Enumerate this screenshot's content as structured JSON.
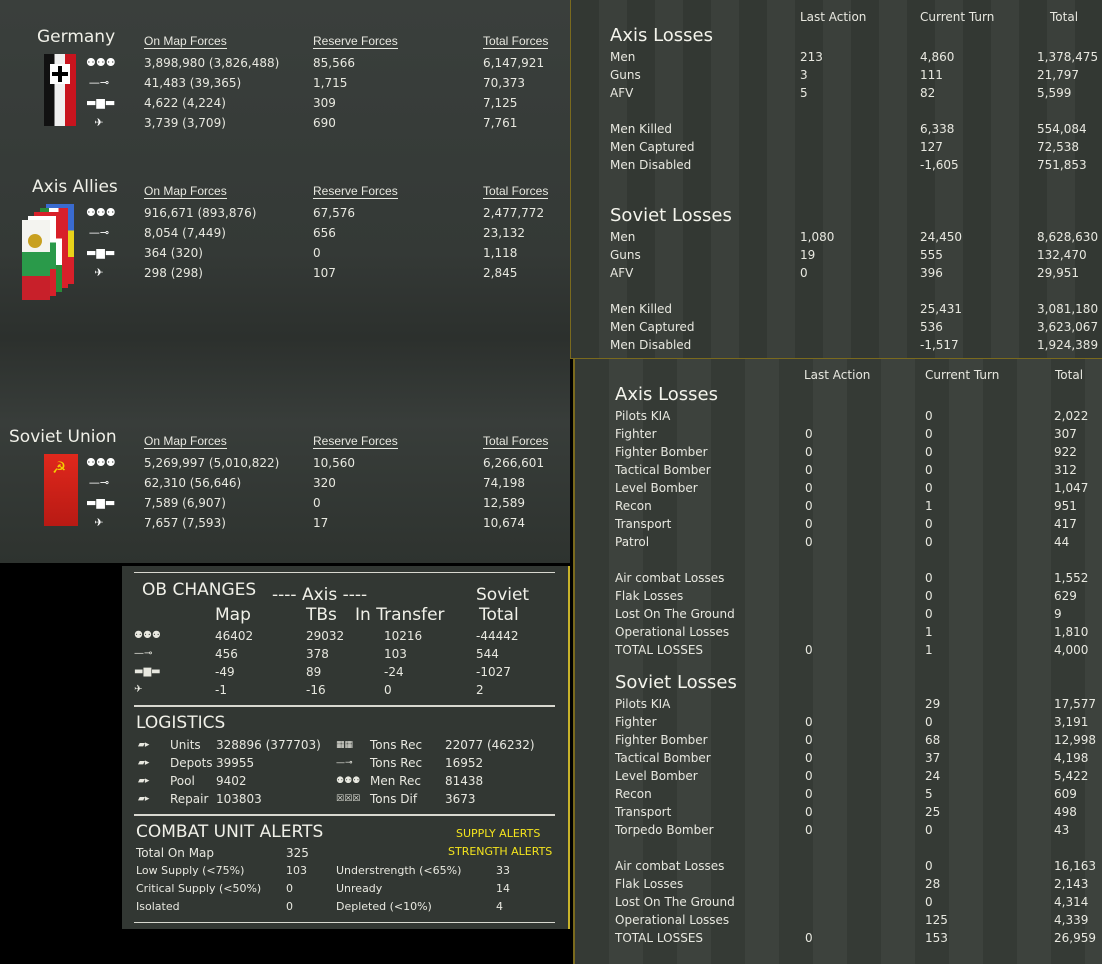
{
  "forces": {
    "headers": {
      "on_map": "On Map Forces",
      "reserve": "Reserve Forces",
      "total": "Total Forces"
    },
    "icons": [
      "infantry-icon",
      "gun-icon",
      "tank-icon",
      "aircraft-icon"
    ],
    "icon_glyphs": [
      "⚉⚉⚉",
      "—⊸",
      "▬▆▬",
      "✈"
    ],
    "countries": [
      {
        "name": "Germany",
        "rows": [
          {
            "on_map": "3,898,980 (3,826,488)",
            "reserve": "85,566",
            "total": "6,147,921"
          },
          {
            "on_map": "41,483 (39,365)",
            "reserve": "1,715",
            "total": "70,373"
          },
          {
            "on_map": "4,622 (4,224)",
            "reserve": "309",
            "total": "7,125"
          },
          {
            "on_map": "3,739 (3,709)",
            "reserve": "690",
            "total": "7,761"
          }
        ]
      },
      {
        "name": "Axis Allies",
        "rows": [
          {
            "on_map": "916,671 (893,876)",
            "reserve": "67,576",
            "total": "2,477,772"
          },
          {
            "on_map": "8,054 (7,449)",
            "reserve": "656",
            "total": "23,132"
          },
          {
            "on_map": "364 (320)",
            "reserve": "0",
            "total": "1,118"
          },
          {
            "on_map": "298 (298)",
            "reserve": "107",
            "total": "2,845"
          }
        ]
      },
      {
        "name": "Soviet Union",
        "rows": [
          {
            "on_map": "5,269,997 (5,010,822)",
            "reserve": "10,560",
            "total": "6,266,601"
          },
          {
            "on_map": "62,310 (56,646)",
            "reserve": "320",
            "total": "74,198"
          },
          {
            "on_map": "7,589 (6,907)",
            "reserve": "0",
            "total": "12,589"
          },
          {
            "on_map": "7,657 (7,593)",
            "reserve": "17",
            "total": "10,674"
          }
        ]
      }
    ]
  },
  "ground_losses": {
    "headers": {
      "last": "Last Action",
      "current": "Current Turn",
      "total": "Total"
    },
    "sections": [
      {
        "title": "Axis Losses",
        "groups": [
          [
            {
              "label": "Men",
              "last": "213",
              "current": "4,860",
              "total": "1,378,475"
            },
            {
              "label": "Guns",
              "last": "3",
              "current": "111",
              "total": "21,797"
            },
            {
              "label": "AFV",
              "last": "5",
              "current": "82",
              "total": "5,599"
            }
          ],
          [
            {
              "label": "Men Killed",
              "last": "",
              "current": "6,338",
              "total": "554,084"
            },
            {
              "label": "Men Captured",
              "last": "",
              "current": "127",
              "total": "72,538"
            },
            {
              "label": "Men Disabled",
              "last": "",
              "current": "-1,605",
              "total": "751,853"
            }
          ]
        ]
      },
      {
        "title": "Soviet Losses",
        "groups": [
          [
            {
              "label": "Men",
              "last": "1,080",
              "current": "24,450",
              "total": "8,628,630"
            },
            {
              "label": "Guns",
              "last": "19",
              "current": "555",
              "total": "132,470"
            },
            {
              "label": "AFV",
              "last": "0",
              "current": "396",
              "total": "29,951"
            }
          ],
          [
            {
              "label": "Men Killed",
              "last": "",
              "current": "25,431",
              "total": "3,081,180"
            },
            {
              "label": "Men Captured",
              "last": "",
              "current": "536",
              "total": "3,623,067"
            },
            {
              "label": "Men Disabled",
              "last": "",
              "current": "-1,517",
              "total": "1,924,389"
            }
          ]
        ]
      }
    ]
  },
  "air_losses": {
    "headers": {
      "last": "Last Action",
      "current": "Current Turn",
      "total": "Total"
    },
    "sections": [
      {
        "title": "Axis Losses",
        "groups": [
          [
            {
              "label": "Pilots KIA",
              "last": "",
              "current": "0",
              "total": "2,022"
            },
            {
              "label": "Fighter",
              "last": "0",
              "current": "0",
              "total": "307"
            },
            {
              "label": "Fighter Bomber",
              "last": "0",
              "current": "0",
              "total": "922"
            },
            {
              "label": "Tactical Bomber",
              "last": "0",
              "current": "0",
              "total": "312"
            },
            {
              "label": "Level Bomber",
              "last": "0",
              "current": "0",
              "total": "1,047"
            },
            {
              "label": "Recon",
              "last": "0",
              "current": "1",
              "total": "951"
            },
            {
              "label": "Transport",
              "last": "0",
              "current": "0",
              "total": "417"
            },
            {
              "label": "Patrol",
              "last": "0",
              "current": "0",
              "total": "44"
            }
          ],
          [
            {
              "label": "Air combat Losses",
              "last": "",
              "current": "0",
              "total": "1,552"
            },
            {
              "label": "Flak Losses",
              "last": "",
              "current": "0",
              "total": "629"
            },
            {
              "label": "Lost On The Ground",
              "last": "",
              "current": "0",
              "total": "9"
            },
            {
              "label": "Operational Losses",
              "last": "",
              "current": "1",
              "total": "1,810"
            },
            {
              "label": "TOTAL LOSSES",
              "last": "0",
              "current": "1",
              "total": "4,000"
            }
          ]
        ]
      },
      {
        "title": "Soviet Losses",
        "groups": [
          [
            {
              "label": "Pilots KIA",
              "last": "",
              "current": "29",
              "total": "17,577"
            },
            {
              "label": "Fighter",
              "last": "0",
              "current": "0",
              "total": "3,191"
            },
            {
              "label": "Fighter Bomber",
              "last": "0",
              "current": "68",
              "total": "12,998"
            },
            {
              "label": "Tactical Bomber",
              "last": "0",
              "current": "37",
              "total": "4,198"
            },
            {
              "label": "Level Bomber",
              "last": "0",
              "current": "24",
              "total": "5,422"
            },
            {
              "label": "Recon",
              "last": "0",
              "current": "5",
              "total": "609"
            },
            {
              "label": "Transport",
              "last": "0",
              "current": "25",
              "total": "498"
            },
            {
              "label": "Torpedo Bomber",
              "last": "0",
              "current": "0",
              "total": "43"
            }
          ],
          [
            {
              "label": "Air combat Losses",
              "last": "",
              "current": "0",
              "total": "16,163"
            },
            {
              "label": "Flak Losses",
              "last": "",
              "current": "28",
              "total": "2,143"
            },
            {
              "label": "Lost On The Ground",
              "last": "",
              "current": "0",
              "total": "4,314"
            },
            {
              "label": "Operational Losses",
              "last": "",
              "current": "125",
              "total": "4,339"
            },
            {
              "label": "TOTAL LOSSES",
              "last": "0",
              "current": "153",
              "total": "26,959"
            }
          ]
        ]
      }
    ]
  },
  "ob_changes": {
    "title": "OB CHANGES",
    "axis_label": "---- Axis ----",
    "soviet_label": "Soviet",
    "col_map": "Map",
    "col_tbs": "TBs",
    "col_transfer": "In Transfer",
    "col_total": "Total",
    "rows": [
      {
        "map": "46402",
        "tbs": "29032",
        "transfer": "10216",
        "total": "-44442"
      },
      {
        "map": "456",
        "tbs": "378",
        "transfer": "103",
        "total": "544"
      },
      {
        "map": "-49",
        "tbs": "89",
        "transfer": "-24",
        "total": "-1027"
      },
      {
        "map": "-1",
        "tbs": "-16",
        "transfer": "0",
        "total": "2"
      }
    ]
  },
  "logistics": {
    "title": "LOGISTICS",
    "left": [
      {
        "icon": "truck-icon",
        "label": "Units",
        "value": "328896 (377703)"
      },
      {
        "icon": "truck-icon",
        "label": "Depots",
        "value": "39955"
      },
      {
        "icon": "truck-icon",
        "label": "Pool",
        "value": "9402"
      },
      {
        "icon": "truck-icon",
        "label": "Repair",
        "value": "103803"
      }
    ],
    "right": [
      {
        "icon": "rail-icon",
        "label": "Tons Rec",
        "value": "22077 (46232)"
      },
      {
        "icon": "gun-icon",
        "label": "Tons Rec",
        "value": "16952"
      },
      {
        "icon": "infantry-icon",
        "label": "Men Rec",
        "value": "81438"
      },
      {
        "icon": "cross-icon",
        "label": "Tons Dif",
        "value": "3673"
      }
    ]
  },
  "combat_alerts": {
    "title": "COMBAT UNIT ALERTS",
    "supply_alerts": "SUPPLY ALERTS",
    "strength_alerts": "STRENGTH ALERTS",
    "total_label": "Total On Map",
    "total_value": "325",
    "left": [
      {
        "label": "Low Supply  (<75%)",
        "value": "103"
      },
      {
        "label": "Critical Supply  (<50%)",
        "value": "0"
      },
      {
        "label": "Isolated",
        "value": "0"
      }
    ],
    "right": [
      {
        "label": "Understrength  (<65%)",
        "value": "33"
      },
      {
        "label": "Unready",
        "value": "14"
      },
      {
        "label": "Depleted  (<10%)",
        "value": "4"
      }
    ]
  }
}
